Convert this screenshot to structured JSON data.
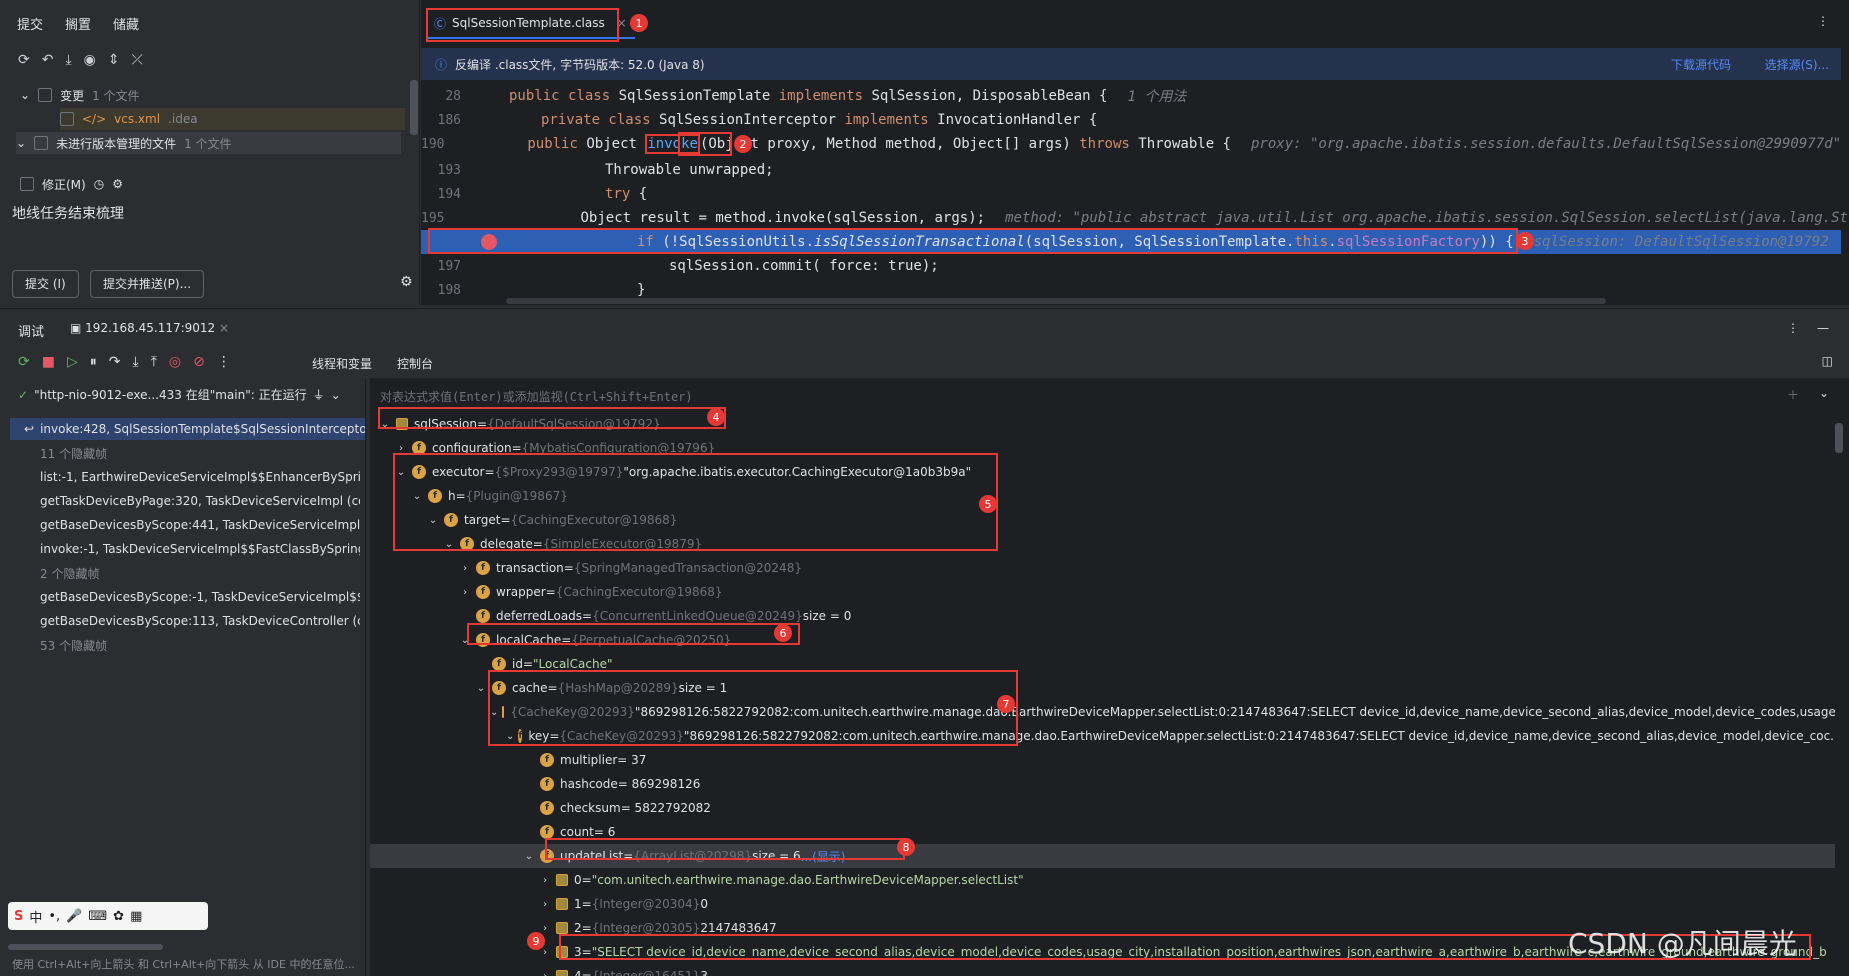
{
  "commit": {
    "tabs": [
      "提交",
      "搁置",
      "储藏"
    ],
    "tree": [
      {
        "label": "变更",
        "count": "1 个文件"
      },
      {
        "label": "vcs.xml",
        "path": ".idea"
      },
      {
        "label": "未进行版本管理的文件",
        "count": "1 个文件"
      }
    ],
    "amend_label": "修正(M)",
    "message": "地线任务结束梳理",
    "commit_btn": "提交 (I)",
    "commit_push_btn": "提交并推送(P)..."
  },
  "editor": {
    "tab": "SqlSessionTemplate.class",
    "info": "反编译 .class文件, 字节码版本: 52.0 (Java 8)",
    "download_source": "下载源代码",
    "choose_source": "选择源(S)...",
    "lines": [
      {
        "n": "28",
        "code": "public class SqlSessionTemplate implements SqlSession, DisposableBean {",
        "hint": "1 个用法"
      },
      {
        "n": "186",
        "code": "private class SqlSessionInterceptor implements InvocationHandler {"
      },
      {
        "n": "190",
        "code": "public Object invoke(Object proxy, Method method, Object[] args) throws Throwable {",
        "hint": "proxy: \"org.apache.ibatis.session.defaults.DefaultSqlSession@2990977d\""
      },
      {
        "n": "193",
        "code": "Throwable unwrapped;"
      },
      {
        "n": "194",
        "code": "try {"
      },
      {
        "n": "195",
        "code": "Object result = method.invoke(sqlSession, args);",
        "hint": "method: \"public abstract java.util.List org.apache.ibatis.session.SqlSession.selectList(java.lang.Str"
      },
      {
        "n": "",
        "code": "if (!SqlSessionUtils.isSqlSessionTransactional(sqlSession, SqlSessionTemplate.this.sqlSessionFactory)) {",
        "hint": "sqlSession: DefaultSqlSession@19792"
      },
      {
        "n": "197",
        "code": "sqlSession.commit( force: true);"
      },
      {
        "n": "198",
        "code": "}"
      }
    ]
  },
  "debug": {
    "title": "调试",
    "session_tab": "192.168.45.117:9012",
    "subtabs": [
      "线程和变量",
      "控制台"
    ],
    "thread": "\"http-nio-9012-exe...433 在组\"main\": 正在运行",
    "eval_placeholder": "对表达式求值(Enter)或添加监视(Ctrl+Shift+Enter)",
    "frames": [
      "invoke:428, SqlSessionTemplate$SqlSessionInterceptor",
      "11 个隐藏帧",
      "list:-1, EarthwireDeviceServiceImpl$$EnhancerBySpringCG",
      "getTaskDeviceByPage:320, TaskDeviceServiceImpl (com.",
      "getBaseDevicesByScope:441, TaskDeviceServiceImpl (co",
      "invoke:-1, TaskDeviceServiceImpl$$FastClassBySpringCG",
      "2 个隐藏帧",
      "getBaseDevicesByScope:-1, TaskDeviceServiceImpl$$Enh",
      "getBaseDevicesByScope:113, TaskDeviceController (com",
      "53 个隐藏帧"
    ],
    "status_hint": "使用 Ctrl+Alt+向上箭头 和 Ctrl+Alt+向下箭头 从 IDE 中的任意位...",
    "vars": [
      {
        "indent": 0,
        "name": "sqlSession",
        "type": "{DefaultSqlSession@19792}",
        "extra": ""
      },
      {
        "indent": 1,
        "name": "configuration",
        "type": "{MybatisConfiguration@19796}",
        "extra": ""
      },
      {
        "indent": 1,
        "name": "executor",
        "type": "{$Proxy293@19797}",
        "extra": "\"org.apache.ibatis.executor.CachingExecutor@1a0b3b9a\""
      },
      {
        "indent": 2,
        "name": "h",
        "type": "{Plugin@19867}",
        "extra": ""
      },
      {
        "indent": 3,
        "name": "target",
        "type": "{CachingExecutor@19868}",
        "extra": ""
      },
      {
        "indent": 4,
        "name": "delegate",
        "type": "{SimpleExecutor@19879}",
        "extra": ""
      },
      {
        "indent": 5,
        "name": "transaction",
        "type": "{SpringManagedTransaction@20248}",
        "extra": ""
      },
      {
        "indent": 5,
        "name": "wrapper",
        "type": "{CachingExecutor@19868}",
        "extra": ""
      },
      {
        "indent": 5,
        "name": "deferredLoads",
        "type": "{ConcurrentLinkedQueue@20249}",
        "extra": "size = 0"
      },
      {
        "indent": 5,
        "name": "localCache",
        "type": "{PerpetualCache@20250}",
        "extra": ""
      },
      {
        "indent": 6,
        "name": "id",
        "type": "",
        "extra": "\"LocalCache\""
      },
      {
        "indent": 6,
        "name": "cache",
        "type": "{HashMap@20289}",
        "extra": "size = 1"
      },
      {
        "indent": 7,
        "name": "",
        "type": "{CacheKey@20293}",
        "extra": "\"869298126:5822792082:com.unitech.earthwire.manage.dao.EarthwireDeviceMapper.selectList:0:2147483647:SELECT  device_id,device_name,device_second_alias,device_model,device_codes,usage_...",
        "show": "(显示)"
      },
      {
        "indent": 8,
        "name": "key",
        "type": "{CacheKey@20293}",
        "extra": "\"869298126:5822792082:com.unitech.earthwire.manage.dao.EarthwireDeviceMapper.selectList:0:2147483647:SELECT  device_id,device_name,device_second_alias,device_model,device_coc...",
        "show": "(显示)"
      },
      {
        "indent": 9,
        "name": "multiplier",
        "type": "",
        "extra": "= 37"
      },
      {
        "indent": 9,
        "name": "hashcode",
        "type": "",
        "extra": "= 869298126"
      },
      {
        "indent": 9,
        "name": "checksum",
        "type": "",
        "extra": "= 5822792082"
      },
      {
        "indent": 9,
        "name": "count",
        "type": "",
        "extra": "= 6"
      },
      {
        "indent": 9,
        "name": "updateList",
        "type": "{ArrayList@20298}",
        "extra": "size = 6",
        "show": "...(显示)"
      },
      {
        "indent": 10,
        "name": "0",
        "type": "",
        "extra": "\"com.unitech.earthwire.manage.dao.EarthwireDeviceMapper.selectList\""
      },
      {
        "indent": 10,
        "name": "1",
        "type": "{Integer@20304}",
        "extra": "0"
      },
      {
        "indent": 10,
        "name": "2",
        "type": "{Integer@20305}",
        "extra": "2147483647"
      },
      {
        "indent": 10,
        "name": "3",
        "type": "",
        "extra": "\"SELECT  device_id,device_name,device_second_alias,device_model,device_codes,usage_city,installation_position,earthwires_json,earthwire_a,earthwire_b,earthwire_c,earthwire_ground,earthwire_ground_b"
      },
      {
        "indent": 10,
        "name": "4",
        "type": "{Integer@16451}",
        "extra": "3"
      }
    ]
  },
  "watermark": "CSDN @凡间晨光",
  "badges": [
    "1",
    "2",
    "3",
    "4",
    "5",
    "6",
    "7",
    "8",
    "9"
  ]
}
